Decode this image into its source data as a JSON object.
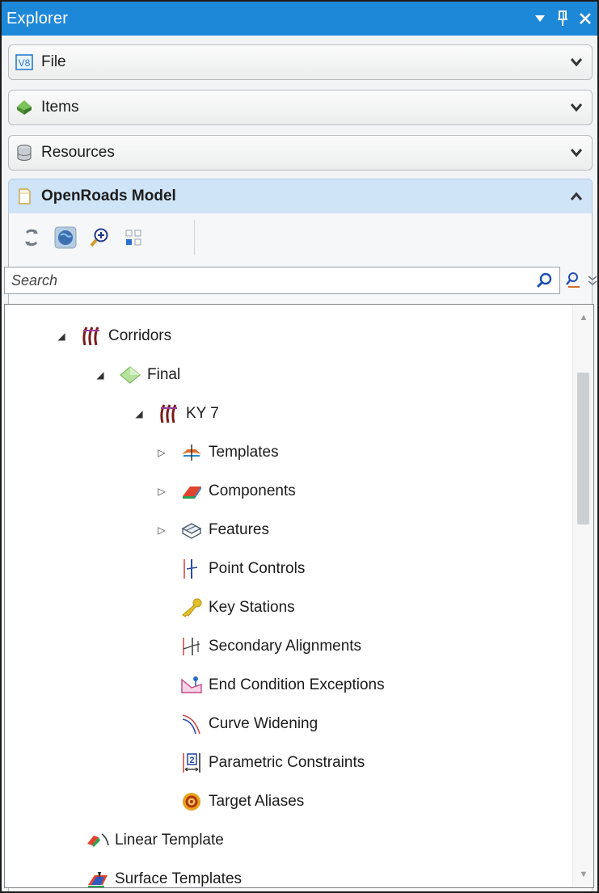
{
  "window": {
    "title": "Explorer",
    "controls": {
      "menu_icon": "dropdown-arrow-icon",
      "pin_icon": "pin-icon",
      "close_icon": "close-icon"
    }
  },
  "sections": [
    {
      "label": "File",
      "icon": "v8-file-icon",
      "state": "collapsed"
    },
    {
      "label": "Items",
      "icon": "items-diamond-icon",
      "state": "collapsed"
    },
    {
      "label": "Resources",
      "icon": "resources-cylinder-icon",
      "state": "collapsed"
    },
    {
      "label": "OpenRoads Model",
      "icon": "openroads-model-icon",
      "state": "expanded"
    }
  ],
  "toolbar": {
    "buttons": [
      "refresh-icon",
      "globe-icon",
      "zoom-in-icon",
      "grid-icon"
    ]
  },
  "search": {
    "placeholder": "Search",
    "go_icon": "search-icon",
    "user_search_icon": "user-search-icon",
    "expand_icon": "double-chevron-icon"
  },
  "tree": [
    {
      "label": "Corridors",
      "expander": "expanded",
      "icon": "corridor-icon"
    },
    {
      "label": "Final",
      "expander": "expanded",
      "icon": "diamond-icon"
    },
    {
      "label": "KY 7",
      "expander": "expanded",
      "icon": "corridor-icon"
    },
    {
      "label": "Templates",
      "expander": "collapsed",
      "icon": "template-icon"
    },
    {
      "label": "Components",
      "expander": "collapsed",
      "icon": "components-icon"
    },
    {
      "label": "Features",
      "expander": "collapsed",
      "icon": "features-icon"
    },
    {
      "label": "Point Controls",
      "expander": "none",
      "icon": "point-control-icon"
    },
    {
      "label": "Key Stations",
      "expander": "none",
      "icon": "key-icon"
    },
    {
      "label": "Secondary Alignments",
      "expander": "none",
      "icon": "secondary-alignment-icon"
    },
    {
      "label": "End Condition Exceptions",
      "expander": "none",
      "icon": "end-condition-icon"
    },
    {
      "label": "Curve Widening",
      "expander": "none",
      "icon": "curve-widening-icon"
    },
    {
      "label": "Parametric Constraints",
      "expander": "none",
      "icon": "parametric-icon"
    },
    {
      "label": "Target Aliases",
      "expander": "none",
      "icon": "target-icon"
    },
    {
      "label": "Linear Template",
      "expander": "none",
      "icon": "linear-template-icon"
    },
    {
      "label": "Surface Templates",
      "expander": "none",
      "icon": "surface-template-icon"
    }
  ],
  "colors": {
    "titlebar": "#1e88d8",
    "active_section": "#cfe4f6"
  }
}
